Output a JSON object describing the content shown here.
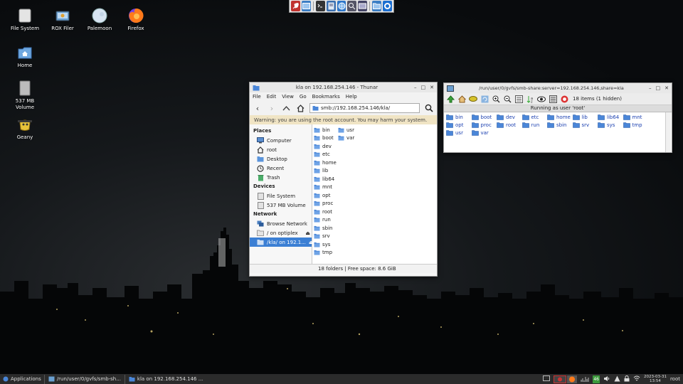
{
  "desktop": {
    "icons": [
      {
        "label": "File System",
        "icon": "drive-icon"
      },
      {
        "label": "ROX Filer",
        "icon": "rox-filer-icon"
      },
      {
        "label": "Palemoon",
        "icon": "palemoon-icon"
      },
      {
        "label": "Firefox",
        "icon": "firefox-icon"
      },
      {
        "label": "Home",
        "icon": "home-folder-icon"
      },
      {
        "label": "537 MB\nVolume",
        "label_line1": "537 MB",
        "label_line2": "Volume",
        "icon": "volume-icon"
      },
      {
        "label": "Geany",
        "icon": "geany-icon"
      }
    ]
  },
  "launcher": {
    "items": [
      "rocket-icon",
      "desktop-icon",
      "terminal-icon",
      "text-editor-icon",
      "globe-icon",
      "search-icon",
      "screenshot-icon",
      "folder-icon",
      "browser-icon"
    ]
  },
  "thunar": {
    "title": "kla on 192.168.254.146 - Thunar",
    "menu": [
      "File",
      "Edit",
      "View",
      "Go",
      "Bookmarks",
      "Help"
    ],
    "location": "smb://192.168.254.146/kla/",
    "warning": "Warning: you are using the root account. You may harm your system.",
    "sidebar": {
      "places_header": "Places",
      "places": [
        "Computer",
        "root",
        "Desktop",
        "Recent",
        "Trash"
      ],
      "devices_header": "Devices",
      "devices": [
        "File System",
        "537 MB Volume"
      ],
      "network_header": "Network",
      "network": [
        "Browse Network",
        "/ on optiplex",
        "/kla/ on 192.1..."
      ]
    },
    "files_col1": [
      "bin",
      "boot",
      "dev",
      "etc",
      "home",
      "lib",
      "lib64",
      "mnt",
      "opt",
      "proc",
      "root",
      "run",
      "sbin",
      "srv",
      "sys",
      "tmp"
    ],
    "files_col2": [
      "usr",
      "var"
    ],
    "status": "18 folders  |  Free space: 8.6 GiB"
  },
  "rox": {
    "title": "/run/user/0/gvfs/smb-share:server=192.168.254.146,share=kla",
    "item_count": "18 items (1 hidden)",
    "message": "Running as user 'root'",
    "rows": [
      [
        "bin",
        "boot",
        "dev",
        "etc",
        "home",
        "lib",
        "lib64",
        "mnt"
      ],
      [
        "opt",
        "proc",
        "root",
        "run",
        "sbin",
        "srv",
        "sys",
        "tmp"
      ],
      [
        "usr",
        "var"
      ]
    ]
  },
  "taskbar": {
    "applications": "Applications",
    "tasks": [
      "/run/user/0/gvfs/smb-sh...",
      "kla on 192.168.254.146 ..."
    ],
    "battery_badge": "46",
    "clock_date": "2023-03-31",
    "clock_time": "13:54",
    "user": "root"
  },
  "colors": {
    "folder_blue": "#4a86d8",
    "selection": "#3b7fd4",
    "warning_bg": "#f0e4c4",
    "taskbar_bg": "#2b2b2b"
  }
}
